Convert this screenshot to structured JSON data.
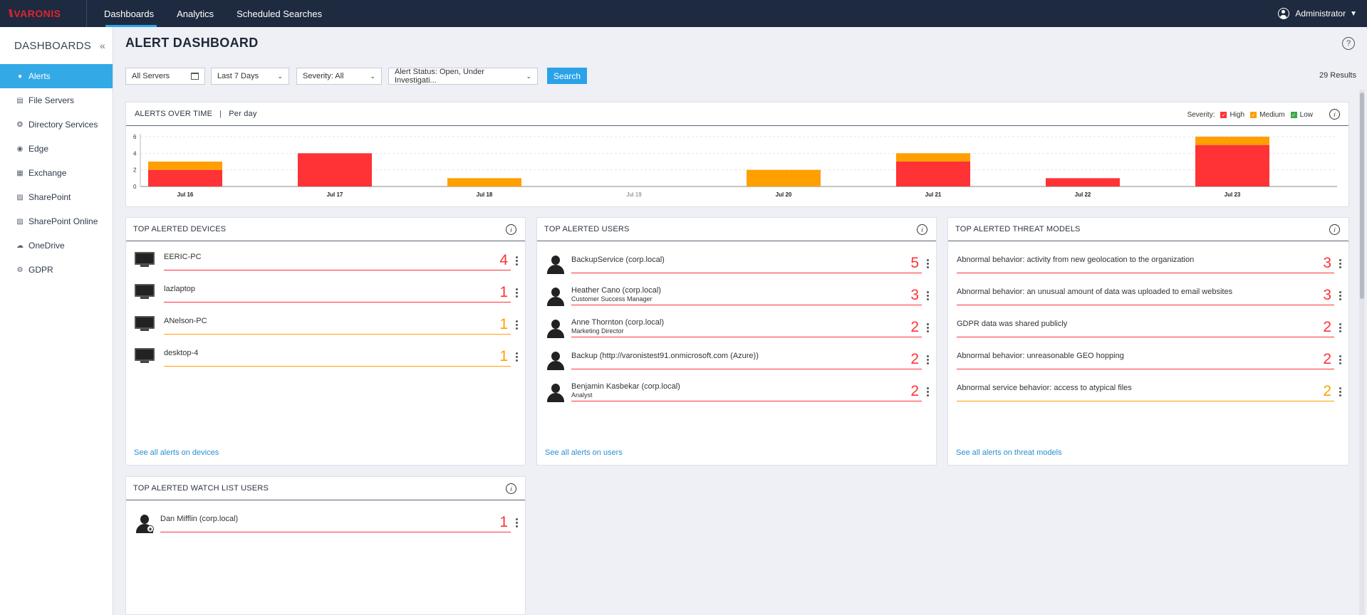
{
  "nav": {
    "logo": "VARONIS",
    "tabs": [
      "Dashboards",
      "Analytics",
      "Scheduled Searches"
    ],
    "user": "Administrator"
  },
  "sidebar": {
    "title": "DASHBOARDS",
    "items": [
      {
        "label": "Alerts",
        "icon": "bell-icon"
      },
      {
        "label": "File Servers",
        "icon": "server-icon"
      },
      {
        "label": "Directory Services",
        "icon": "globe-icon"
      },
      {
        "label": "Edge",
        "icon": "shield-icon"
      },
      {
        "label": "Exchange",
        "icon": "exchange-icon"
      },
      {
        "label": "SharePoint",
        "icon": "sharepoint-icon"
      },
      {
        "label": "SharePoint Online",
        "icon": "sharepoint-online-icon"
      },
      {
        "label": "OneDrive",
        "icon": "cloud-icon"
      },
      {
        "label": "GDPR",
        "icon": "gear-icon"
      }
    ]
  },
  "page": {
    "title": "ALERT DASHBOARD",
    "results": "29 Results"
  },
  "filters": {
    "servers": "All Servers",
    "period": "Last 7 Days",
    "severity": "Severity:  All",
    "status": "Alert Status:  Open, Under Investigati...",
    "search_label": "Search"
  },
  "colors": {
    "high": "#ff3236",
    "medium": "#ff9f00",
    "low": "#3aa94a",
    "accent": "#2ba2e8"
  },
  "chart_data": {
    "type": "bar",
    "title": "ALERTS OVER TIME",
    "subtitle": "Per day",
    "legend_title": "Severity:",
    "categories": [
      "Jul 16",
      "Jul 17",
      "Jul 18",
      "Jul 19",
      "Jul 20",
      "Jul 21",
      "Jul 22",
      "Jul 23"
    ],
    "series": [
      {
        "name": "High",
        "values": [
          2,
          4,
          0,
          0,
          0,
          3,
          1,
          5
        ]
      },
      {
        "name": "Medium",
        "values": [
          1,
          0,
          1,
          0,
          2,
          1,
          0,
          1
        ]
      },
      {
        "name": "Low",
        "values": [
          0,
          0,
          0,
          0,
          0,
          0,
          0,
          0
        ]
      }
    ],
    "yticks": [
      0,
      2,
      4,
      6
    ],
    "ylim": [
      0,
      6
    ],
    "stacked": true,
    "legend_position": "top-right"
  },
  "devices": {
    "title": "TOP ALERTED DEVICES",
    "see_all": "See all alerts on devices",
    "rows": [
      {
        "name": "EERIC-PC",
        "count": "4",
        "severity": "high"
      },
      {
        "name": "lazlaptop",
        "count": "1",
        "severity": "high"
      },
      {
        "name": "ANelson-PC",
        "count": "1",
        "severity": "medium"
      },
      {
        "name": "desktop-4",
        "count": "1",
        "severity": "medium"
      }
    ]
  },
  "users": {
    "title": "TOP ALERTED USERS",
    "see_all": "See all alerts on users",
    "rows": [
      {
        "name": "BackupService (corp.local)",
        "sub": "",
        "count": "5",
        "severity": "high"
      },
      {
        "name": "Heather Cano (corp.local)",
        "sub": "Customer Success Manager",
        "count": "3",
        "severity": "high"
      },
      {
        "name": "Anne Thornton (corp.local)",
        "sub": "Marketing Director",
        "count": "2",
        "severity": "high"
      },
      {
        "name": "Backup (http://varonistest91.onmicrosoft.com (Azure))",
        "sub": "",
        "count": "2",
        "severity": "high"
      },
      {
        "name": "Benjamin Kasbekar (corp.local)",
        "sub": "Analyst",
        "count": "2",
        "severity": "high"
      }
    ]
  },
  "threats": {
    "title": "TOP ALERTED THREAT MODELS",
    "see_all": "See all alerts on threat models",
    "rows": [
      {
        "name": "Abnormal behavior: activity from new geolocation to the organization",
        "count": "3",
        "severity": "high"
      },
      {
        "name": "Abnormal behavior: an unusual amount of data was uploaded to email websites",
        "count": "3",
        "severity": "high"
      },
      {
        "name": "GDPR data was shared publicly",
        "count": "2",
        "severity": "high"
      },
      {
        "name": "Abnormal behavior: unreasonable GEO hopping",
        "count": "2",
        "severity": "high"
      },
      {
        "name": "Abnormal service behavior: access to atypical files",
        "count": "2",
        "severity": "medium"
      }
    ]
  },
  "watchlist": {
    "title": "TOP ALERTED WATCH LIST USERS",
    "rows": [
      {
        "name": "Dan Mifflin (corp.local)",
        "count": "1",
        "severity": "high"
      }
    ]
  }
}
